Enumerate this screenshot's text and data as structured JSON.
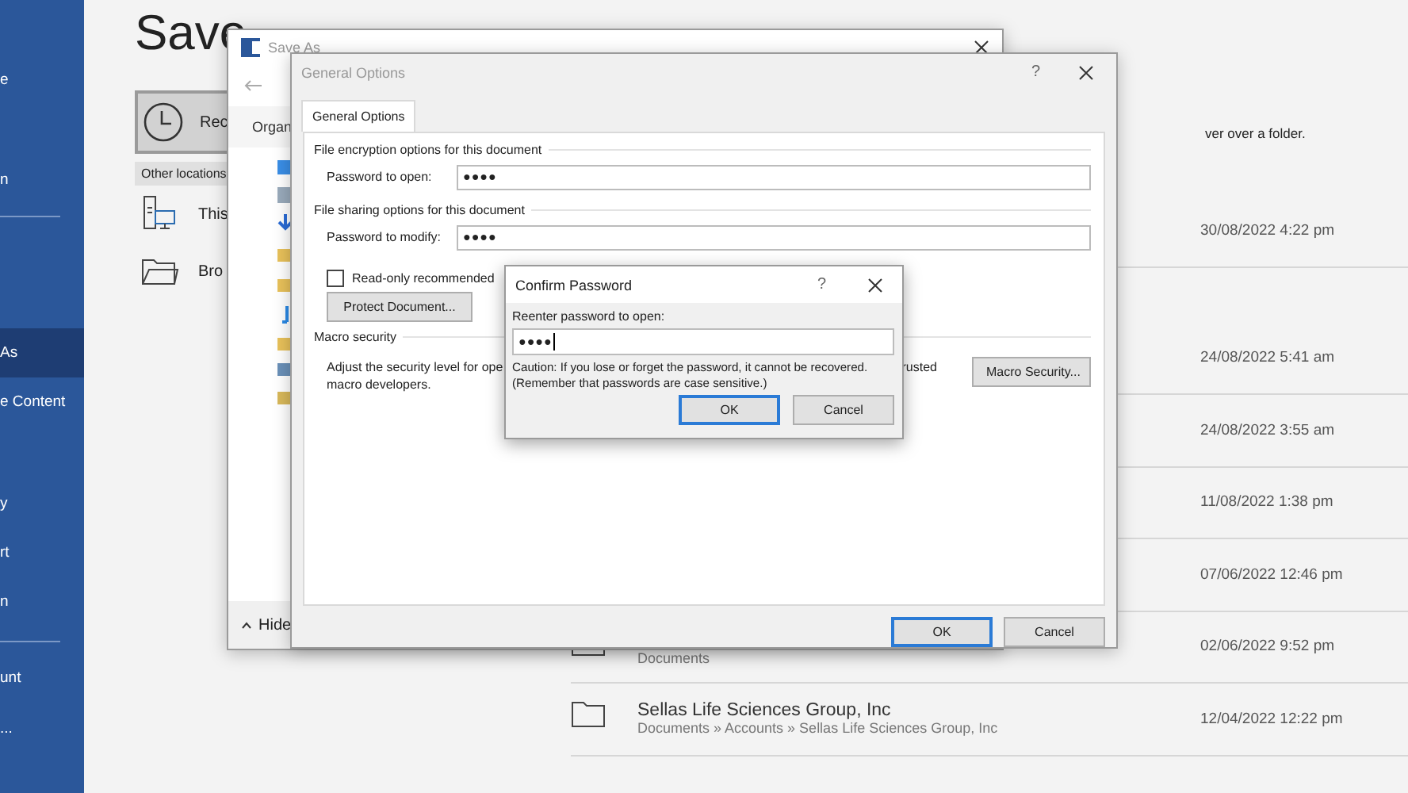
{
  "sidebar": {
    "groups": [
      {
        "items": [
          {
            "label": "e",
            "selected": false
          },
          {
            "label": "n",
            "selected": false
          }
        ]
      },
      {
        "items": [
          {
            "label": "As",
            "selected": true
          },
          {
            "label": "e Content",
            "selected": false
          },
          {
            "label": "y",
            "selected": false
          },
          {
            "label": "rt",
            "selected": false
          },
          {
            "label": "n",
            "selected": false
          }
        ]
      },
      {
        "items": [
          {
            "label": "unt",
            "selected": false
          },
          {
            "label": "...",
            "selected": false
          }
        ]
      }
    ]
  },
  "page_title": "Save",
  "locations": {
    "recent": {
      "label": "Rec",
      "selected": true
    },
    "section_header": "Other locations",
    "items": [
      {
        "kind": "computer",
        "label": "This"
      },
      {
        "kind": "folder",
        "label": "Bro"
      }
    ]
  },
  "file_list": {
    "hint": "ver over a folder.",
    "rows": [
      {
        "date": "30/08/2022 4:22 pm"
      },
      {
        "date": "24/08/2022 5:41 am"
      },
      {
        "date": "24/08/2022 3:55 am"
      },
      {
        "date": "11/08/2022 1:38 pm"
      },
      {
        "date": "07/06/2022 12:46 pm"
      },
      {
        "path": "Documents",
        "date": "02/06/2022 9:52 pm"
      },
      {
        "name": "Sellas Life Sciences Group, Inc",
        "path": "Documents » Accounts » Sellas Life Sciences Group, Inc",
        "date": "12/04/2022 12:22 pm"
      }
    ]
  },
  "save_as_dialog": {
    "title": "Save As",
    "toolbar_label": "Organ",
    "hide_label": "Hide"
  },
  "general_options_dialog": {
    "title": "General Options",
    "help": "?",
    "tabs": [
      {
        "label": "General Options",
        "selected": true
      }
    ],
    "encryption": {
      "heading": "File encryption options for this document",
      "label": "Password to open:",
      "value": "●●●●"
    },
    "sharing": {
      "heading": "File sharing options for this document",
      "label": "Password to modify:",
      "value": "●●●●"
    },
    "read_only": {
      "label": "Read-only recommended",
      "checked": false
    },
    "protect_button": "Protect Document...",
    "macro": {
      "heading": "Macro security",
      "text_start": "Adjust the security level for ope",
      "text_end": "rusted",
      "text_line2": "macro developers.",
      "button": "Macro Security..."
    },
    "buttons": [
      {
        "label": "OK",
        "default": true
      },
      {
        "label": "Cancel",
        "default": false
      }
    ]
  },
  "confirm_dialog": {
    "title": "Confirm Password",
    "help": "?",
    "label": "Reenter password to open:",
    "value": "●●●●",
    "focused": true,
    "caution": [
      "Caution: If you lose or forget the password, it cannot be recovered.",
      "(Remember that passwords are case sensitive.)"
    ],
    "buttons": [
      {
        "label": "OK",
        "default": true
      },
      {
        "label": "Cancel",
        "default": false
      }
    ]
  }
}
